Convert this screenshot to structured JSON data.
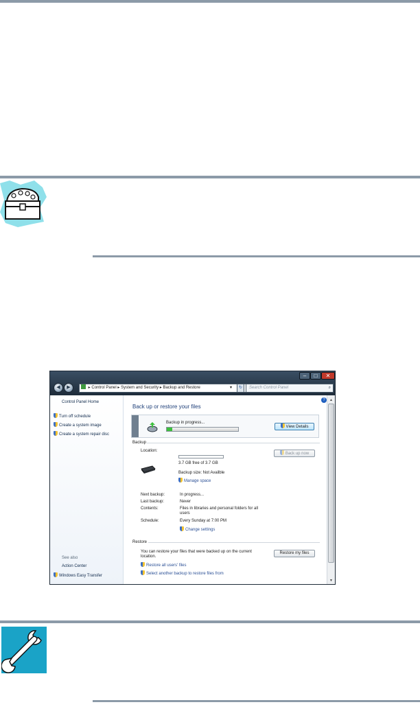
{
  "colors": {
    "rule": "#8c9aa8",
    "titlebar": "#2b3c4d",
    "close": "#c0392b",
    "link": "#2a4f95",
    "progress": "#3cbf3c"
  },
  "icons": {
    "note": "treasure-chest-icon",
    "tip": "wrench-icon"
  },
  "window": {
    "address": {
      "back": "◀",
      "forward": "▶",
      "segments": [
        "Control Panel",
        "System and Security",
        "Backup and Restore"
      ]
    },
    "search_placeholder": "Search Control Panel",
    "left": {
      "home": "Control Panel Home",
      "tasks": [
        "Turn off schedule",
        "Create a system image",
        "Create a system repair disc"
      ],
      "see_also": "See also",
      "action_center": "Action Center",
      "easy_transfer": "Windows Easy Transfer"
    },
    "main": {
      "title": "Back up or restore your files",
      "progress_text": "Backup in progress...",
      "progress_fraction": 0.08,
      "view_details": "View Details",
      "backup_section": "Backup",
      "location_label": "Location:",
      "location_fill": 0.0,
      "free_space": "3.7 GB free of 3.7 GB",
      "backup_size": "Backup size: Not Availble",
      "manage_space": "Manage space",
      "back_up_now": "Back up now",
      "next_backup_label": "Next backup:",
      "next_backup_value": "In progress...",
      "last_backup_label": "Last backup:",
      "last_backup_value": "Never",
      "contents_label": "Contents:",
      "contents_value_1": "Files in libraries and personal folders for all",
      "contents_value_2": "users",
      "schedule_label": "Schedule:",
      "schedule_value": "Every Sunday at 7:00 PM",
      "change_settings": "Change settings",
      "restore_section": "Restore",
      "restore_text_1": "You can restore your files that were backed up on the current",
      "restore_text_2": "location.",
      "restore_my_files": "Restore my files",
      "restore_all_users": "Restore all users' files",
      "select_another": "Select another backup to restore files from"
    }
  }
}
